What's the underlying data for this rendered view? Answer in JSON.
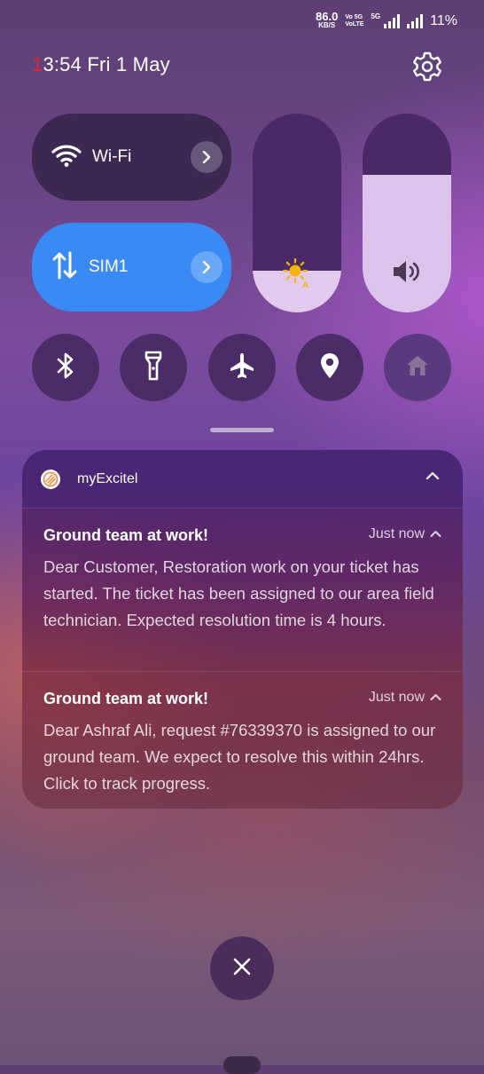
{
  "status_bar": {
    "speed_value": "86.0",
    "speed_unit": "KB/S",
    "volte1": "Vo 5G",
    "volte2": "VoLTE",
    "network": "5G",
    "battery": "11%"
  },
  "clock": {
    "first_digit": "1",
    "rest": "3:54",
    "date": "Fri 1 May"
  },
  "tiles": {
    "wifi_label": "Wi-Fi",
    "sim_label": "SIM1"
  },
  "sliders": {
    "brightness_level": 0.21,
    "volume_level": 0.69
  },
  "notification_group": {
    "app_name": "myExcitel",
    "items": [
      {
        "title": "Ground team at work!",
        "time": "Just now",
        "body": "Dear Customer, Restoration work on your ticket has started. The ticket has been assigned to our area field technician. Expected resolution time is 4 hours."
      },
      {
        "title": "Ground team at work!",
        "time": "Just now",
        "body": "Dear Ashraf Ali, request #76339370 is assigned to our ground team. We expect to resolve this within 24hrs. Click to track progress."
      }
    ]
  },
  "colors": {
    "accent": "#3a8af5",
    "tile_dark": "#3d2854",
    "clock_first_digit": "#e0262f",
    "sun": "#f5b400"
  }
}
